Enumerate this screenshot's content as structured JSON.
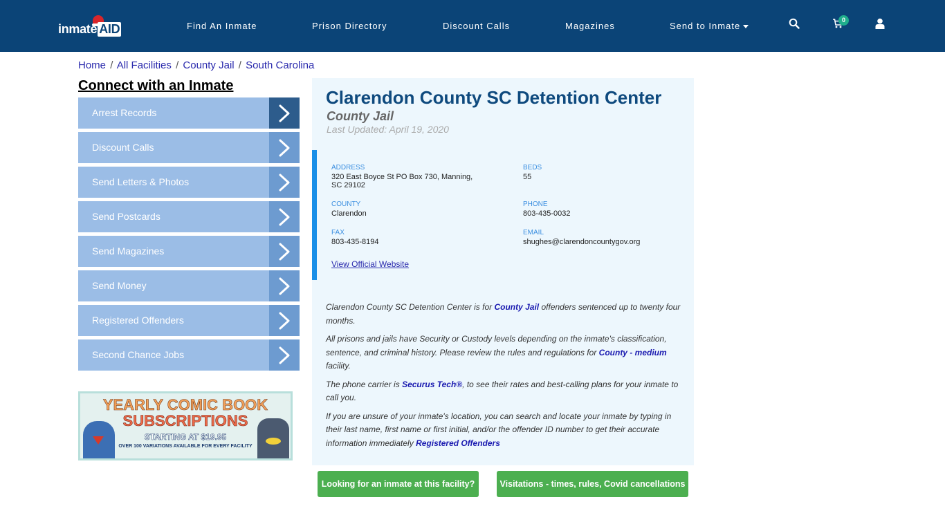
{
  "header": {
    "logo_text": "inmate",
    "logo_accent": "AID",
    "nav": [
      {
        "label": "Find An Inmate"
      },
      {
        "label": "Prison Directory"
      },
      {
        "label": "Discount Calls"
      },
      {
        "label": "Magazines"
      },
      {
        "label": "Send to Inmate"
      }
    ],
    "cart_count": "0",
    "icons": [
      "search-icon",
      "cart-icon",
      "user-icon"
    ]
  },
  "breadcrumb": [
    {
      "label": "Home"
    },
    {
      "label": "All Facilities"
    },
    {
      "label": "County Jail"
    },
    {
      "label": "South Carolina"
    }
  ],
  "breadcrumb_separator": "/",
  "sidebar": {
    "title": "Connect with an Inmate",
    "items": [
      {
        "label": "Arrest Records"
      },
      {
        "label": "Discount Calls"
      },
      {
        "label": "Send Letters & Photos"
      },
      {
        "label": "Send Postcards"
      },
      {
        "label": "Send Magazines"
      },
      {
        "label": "Send Money"
      },
      {
        "label": "Registered Offenders"
      },
      {
        "label": "Second Chance Jobs"
      }
    ],
    "ad": {
      "line1": "YEARLY COMIC BOOK",
      "line2": "SUBSCRIPTIONS",
      "line3": "STARTING AT $19.95",
      "line4": "OVER 100 VARIATIONS AVAILABLE FOR EVERY FACILITY"
    }
  },
  "facility": {
    "name": "Clarendon County SC Detention Center",
    "type": "County Jail",
    "last_updated": "Last Updated: April 19, 2020",
    "fields": {
      "address_label": "ADDRESS",
      "address_line1": "320 East Boyce St PO Box 730, Manning,",
      "address_line2": "SC 29102",
      "beds_label": "BEDS",
      "beds": "55",
      "county_label": "COUNTY",
      "county": "Clarendon",
      "phone_label": "PHONE",
      "phone": "803-435-0032",
      "fax_label": "FAX",
      "fax": "803-435-8194",
      "email_label": "EMAIL",
      "email": "shughes@clarendoncountygov.org"
    },
    "website_link": "View Official Website",
    "description": {
      "p1_a": "Clarendon County SC Detention Center is for ",
      "p1_link": "County Jail",
      "p1_b": " offenders sentenced up to twenty four months.",
      "p2_a": "All prisons and jails have Security or Custody levels depending on the inmate's classification, sentence, and criminal history. Please review the rules and regulations for ",
      "p2_link": "County - medium",
      "p2_b": " facility.",
      "p3_a": "The phone carrier is ",
      "p3_link": "Securus Tech®",
      "p3_b": ", to see their rates and best-calling plans for your inmate to call you.",
      "p4_a": "If you are unsure of your inmate's location, you can search and locate your inmate by typing in their last name, first name or first initial, and/or the offender ID number to get their accurate information immediately ",
      "p4_link": "Registered Offenders"
    }
  },
  "actions": {
    "find_inmate": "Looking for an inmate at this facility?",
    "visitations": "Visitations - times, rules, Covid cancellations"
  },
  "colors": {
    "navbar": "#0b4477",
    "sidebar_item": "#9bbde6",
    "accent_blue": "#1a8fe8",
    "panel_bg": "#edf7fd",
    "green_button": "#4caf50",
    "cart_badge": "#1fae8c"
  }
}
